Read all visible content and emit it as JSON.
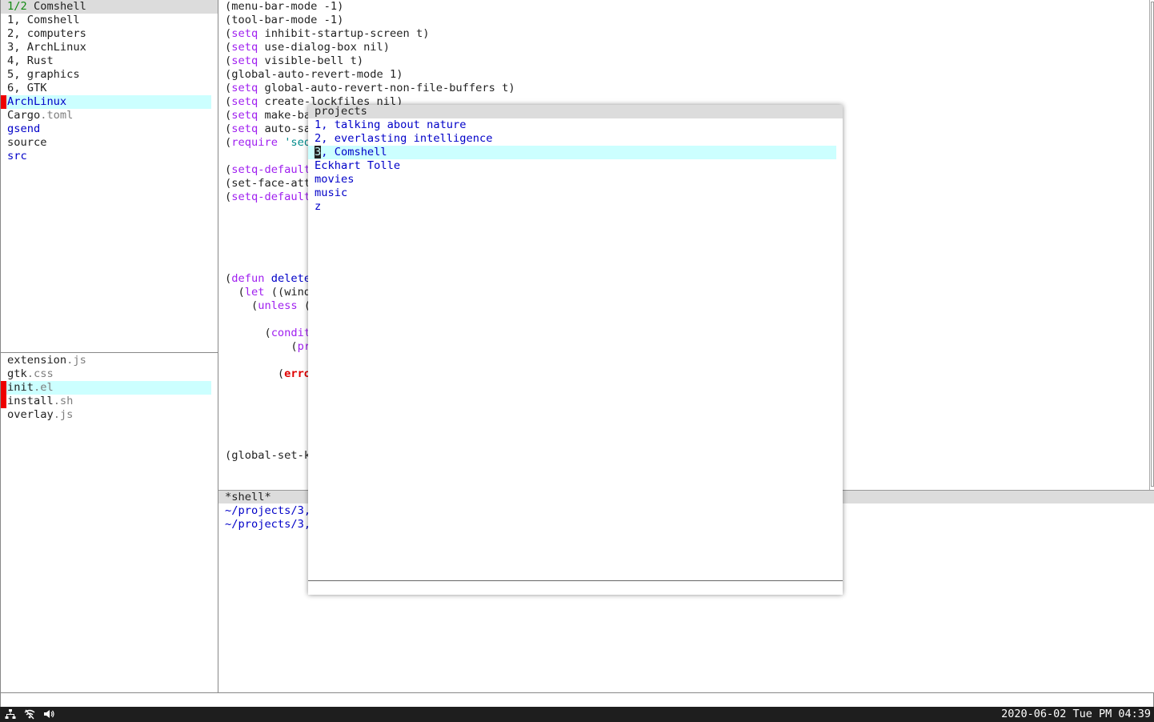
{
  "left_top": {
    "header_page": "1/2",
    "header_title": "Comshell",
    "items": [
      {
        "name": "1, Comshell",
        "ext": "",
        "dir": false
      },
      {
        "name": "2, computers",
        "ext": "",
        "dir": false
      },
      {
        "name": "3, ArchLinux",
        "ext": "",
        "dir": false
      },
      {
        "name": "4, Rust",
        "ext": "",
        "dir": false
      },
      {
        "name": "5, graphics",
        "ext": "",
        "dir": false
      },
      {
        "name": "6, GTK",
        "ext": "",
        "dir": false
      },
      {
        "name": "ArchLinux",
        "ext": "",
        "dir": true
      },
      {
        "name": "Cargo",
        "ext": ".toml",
        "dir": false
      },
      {
        "name": "gsend",
        "ext": "",
        "dir": true
      },
      {
        "name": "source",
        "ext": "",
        "dir": false
      },
      {
        "name": "src",
        "ext": "",
        "dir": true
      }
    ]
  },
  "left_bottom": {
    "items": [
      {
        "name": "extension",
        "ext": ".js"
      },
      {
        "name": "gtk",
        "ext": ".css"
      },
      {
        "name": "init",
        "ext": ".el"
      },
      {
        "name": "install",
        "ext": ".sh"
      },
      {
        "name": "overlay",
        "ext": ".js"
      }
    ]
  },
  "editor": {
    "lines": [
      "(menu-bar-mode -1)",
      "(tool-bar-mode -1)",
      "(setq inhibit-startup-screen t)",
      "(setq use-dialog-box nil)",
      "(setq visible-bell t)",
      "(global-auto-revert-mode 1)",
      "(setq global-auto-revert-non-file-buffers t)",
      "(setq create-lockfiles nil)",
      "(setq make-ba",
      "(setq auto-sa",
      "(require 'seq",
      "",
      "(setq-default",
      "(set-face-att",
      "(setq-default",
      "",
      "",
      "",
      "",
      "",
      "(defun delete",
      "  (let ((wind",
      "    (unless (",
      "",
      "      (condit",
      "          (pr",
      "",
      "        (erro",
      "",
      "",
      "",
      "",
      "",
      "(global-set-k"
    ]
  },
  "shell": {
    "modeline": "*shell*",
    "lines": [
      "~/projects/3,",
      "~/projects/3,"
    ]
  },
  "popup": {
    "title": "projects",
    "items": [
      "1, talking about nature",
      "2, everlasting intelligence",
      "3, Comshell",
      "Eckhart Tolle",
      "movies",
      "music",
      "z"
    ],
    "selected_index": 2
  },
  "taskbar": {
    "clock": "2020-06-02 Tue PM 04:39",
    "icons": [
      "network-icon",
      "wifi-icon",
      "volume-icon"
    ]
  }
}
